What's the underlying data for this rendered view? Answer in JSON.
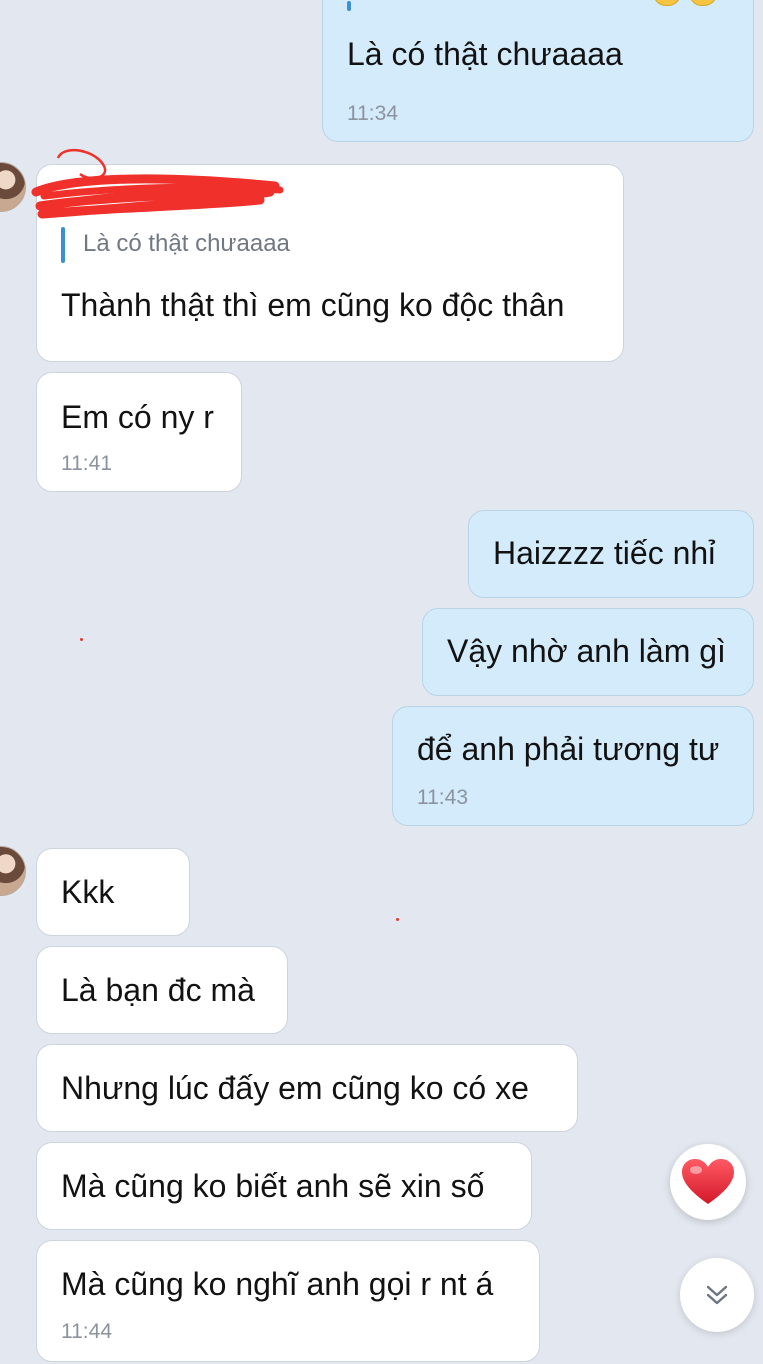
{
  "conversation": {
    "messages": [
      {
        "id": "m1",
        "direction": "out",
        "text": "Là có thật chưaaaa",
        "time": "11:34"
      },
      {
        "id": "m2",
        "direction": "in",
        "quote": "Là có thật chưaaaa",
        "text": "Thành thật thì em cũng ko độc thân"
      },
      {
        "id": "m3",
        "direction": "in",
        "text": "Em có ny r",
        "time": "11:41"
      },
      {
        "id": "m4",
        "direction": "out",
        "text": "Haizzzz tiếc nhỉ"
      },
      {
        "id": "m5",
        "direction": "out",
        "text": "Vậy nhờ anh làm gì"
      },
      {
        "id": "m6",
        "direction": "out",
        "text": "để anh phải tương tư",
        "time": "11:43"
      },
      {
        "id": "m7",
        "direction": "in",
        "text": "Kkk"
      },
      {
        "id": "m8",
        "direction": "in",
        "text": "Là bạn đc mà"
      },
      {
        "id": "m9",
        "direction": "in",
        "text": "Nhưng lúc đấy em cũng ko có xe"
      },
      {
        "id": "m10",
        "direction": "in",
        "text": "Mà cũng ko biết anh sẽ xin số"
      },
      {
        "id": "m11",
        "direction": "in",
        "text": "Mà cũng ko nghĩ anh gọi r nt á",
        "time": "11:44"
      }
    ]
  },
  "controls": {
    "reaction_icon": "heart-icon",
    "scroll_icon": "chevron-double-down-icon"
  },
  "colors": {
    "background": "#e3e7ef",
    "incoming_bubble": "#ffffff",
    "outgoing_bubble": "#d4ebfb",
    "quote_bar": "#3b8fd4",
    "heart": "#e0293a",
    "redaction": "#f0302a"
  }
}
